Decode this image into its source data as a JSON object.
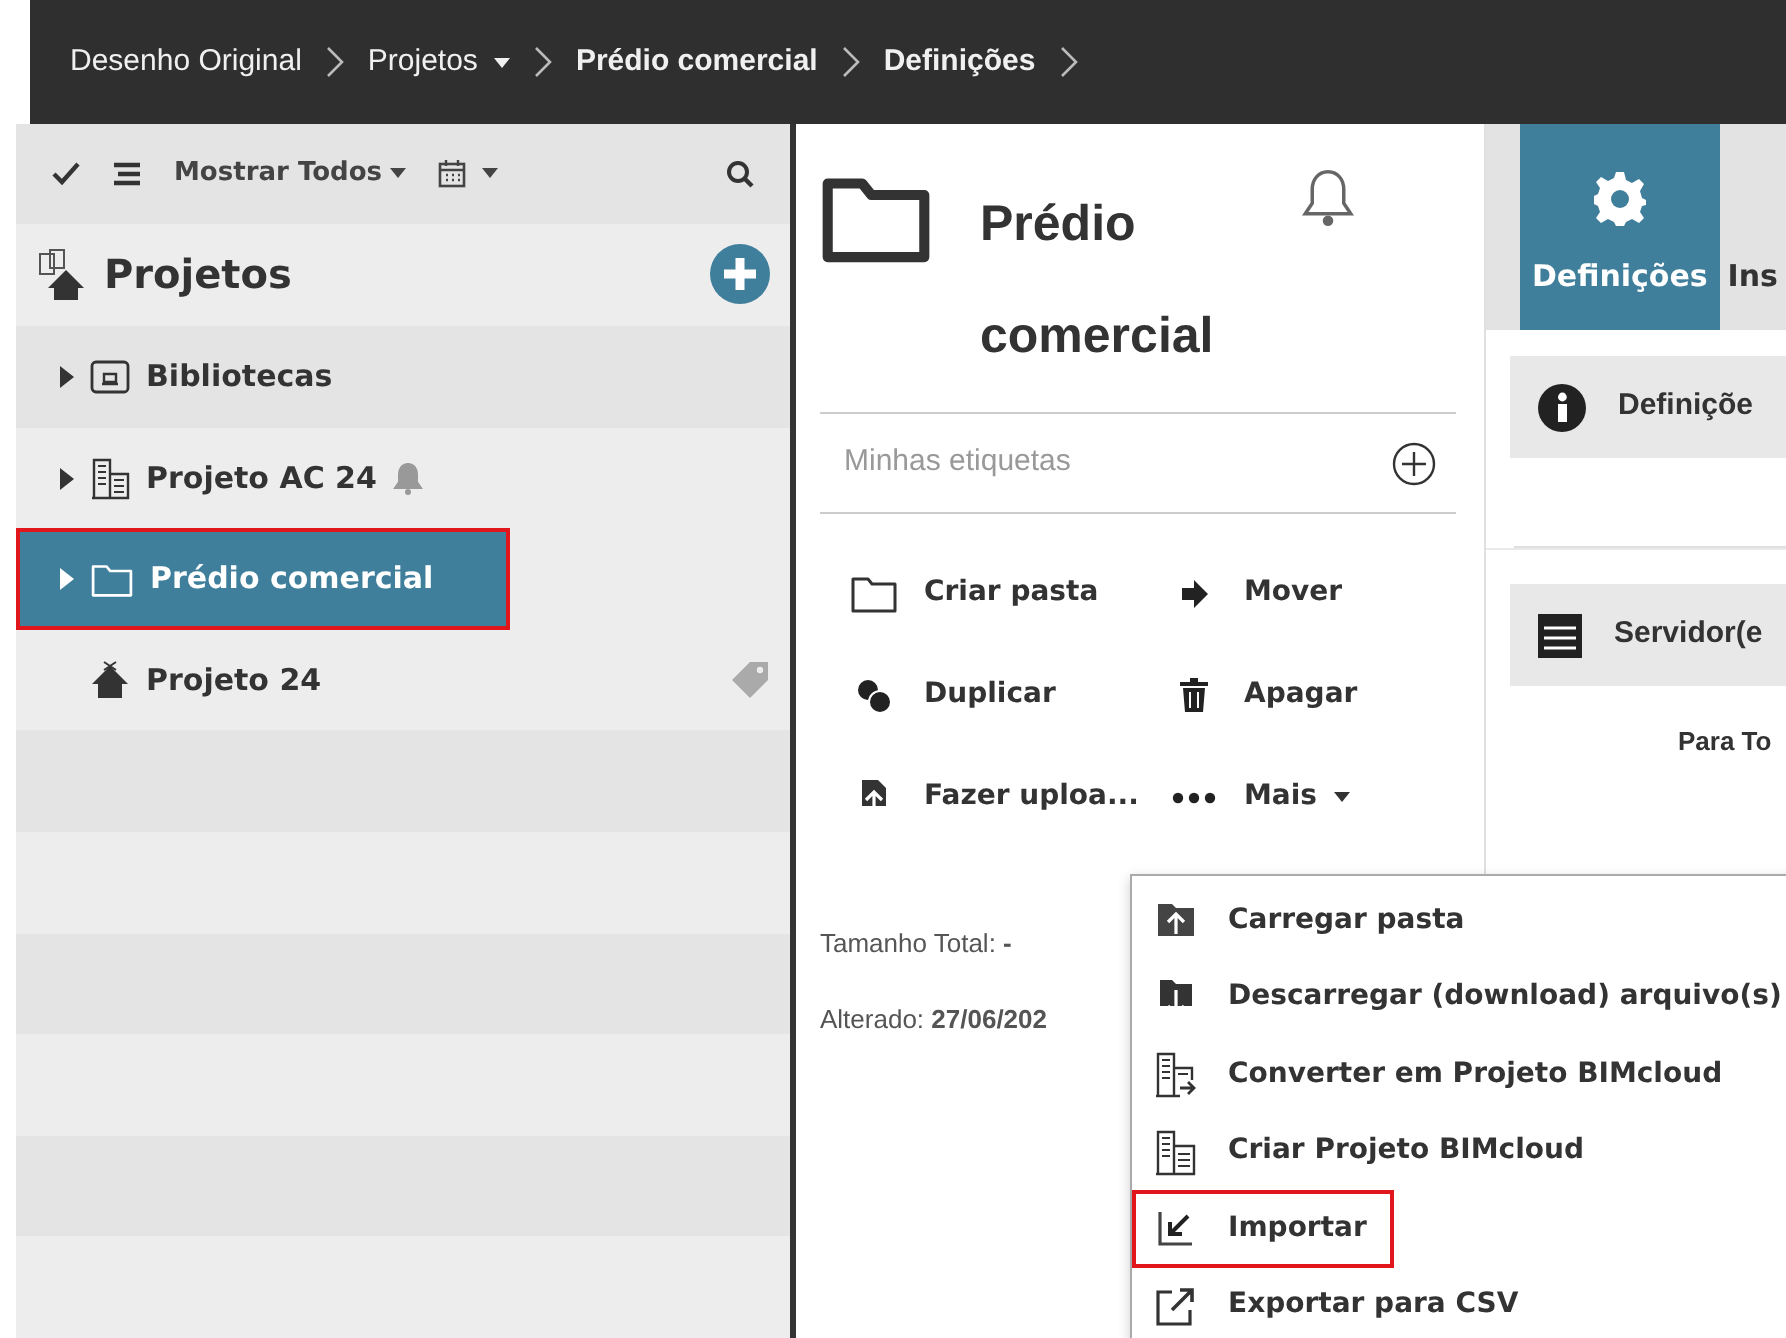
{
  "breadcrumb": [
    {
      "label": "Desenho Original",
      "bold": false,
      "dropdown": false
    },
    {
      "label": "Projetos",
      "bold": false,
      "dropdown": true
    },
    {
      "label": "Prédio comercial",
      "bold": true,
      "dropdown": false
    },
    {
      "label": "Definições",
      "bold": true,
      "dropdown": false
    }
  ],
  "sidebar": {
    "filter": "Mostrar Todos",
    "title": "Projetos",
    "items": [
      {
        "label": "Bibliotecas",
        "kind": "library",
        "expandable": true,
        "selected": false,
        "highlighted": false,
        "bell": false,
        "tag": false
      },
      {
        "label": "Projeto AC 24",
        "kind": "building",
        "expandable": true,
        "selected": false,
        "highlighted": false,
        "bell": true,
        "tag": false
      },
      {
        "label": "Prédio comercial",
        "kind": "folder",
        "expandable": true,
        "selected": true,
        "highlighted": true,
        "bell": false,
        "tag": false
      },
      {
        "label": "Projeto 24",
        "kind": "house",
        "expandable": false,
        "selected": false,
        "highlighted": false,
        "bell": false,
        "tag": true
      }
    ]
  },
  "detail": {
    "title": "Prédio comercial",
    "tags": {
      "placeholder": "Minhas etiquetas"
    },
    "actions": [
      {
        "label": "Criar pasta",
        "kind": "folder",
        "dropdown": false
      },
      {
        "label": "Mover",
        "kind": "move",
        "dropdown": false
      },
      {
        "label": "Duplicar",
        "kind": "duplicate",
        "dropdown": false
      },
      {
        "label": "Apagar",
        "kind": "delete",
        "dropdown": false
      },
      {
        "label": "Fazer uploa...",
        "kind": "upload",
        "dropdown": false
      },
      {
        "label": "Mais",
        "kind": "more",
        "dropdown": true
      }
    ],
    "total_label": "Tamanho Total:",
    "total_value": "-",
    "changed_label": "Alterado:",
    "changed_value": "27/06/202"
  },
  "menu": [
    {
      "label": "Carregar pasta",
      "kind": "upload-folder",
      "highlighted": false
    },
    {
      "label": "Descarregar (download) arquivo(s)",
      "kind": "download",
      "highlighted": false
    },
    {
      "label": "Converter em Projeto BIMcloud",
      "kind": "convert",
      "highlighted": false
    },
    {
      "label": "Criar Projeto BIMcloud",
      "kind": "building",
      "highlighted": false
    },
    {
      "label": "Importar",
      "kind": "import",
      "highlighted": true
    },
    {
      "label": "Exportar para CSV",
      "kind": "export",
      "highlighted": false
    }
  ],
  "settings": {
    "tabs": [
      {
        "label": "Definições",
        "selected": true
      },
      {
        "label": "Ins",
        "selected": false
      }
    ],
    "sections": [
      {
        "label": "Definiçõe",
        "kind": "info"
      },
      {
        "label": "Servidor(e",
        "kind": "server"
      }
    ],
    "column_label": "Para To"
  }
}
